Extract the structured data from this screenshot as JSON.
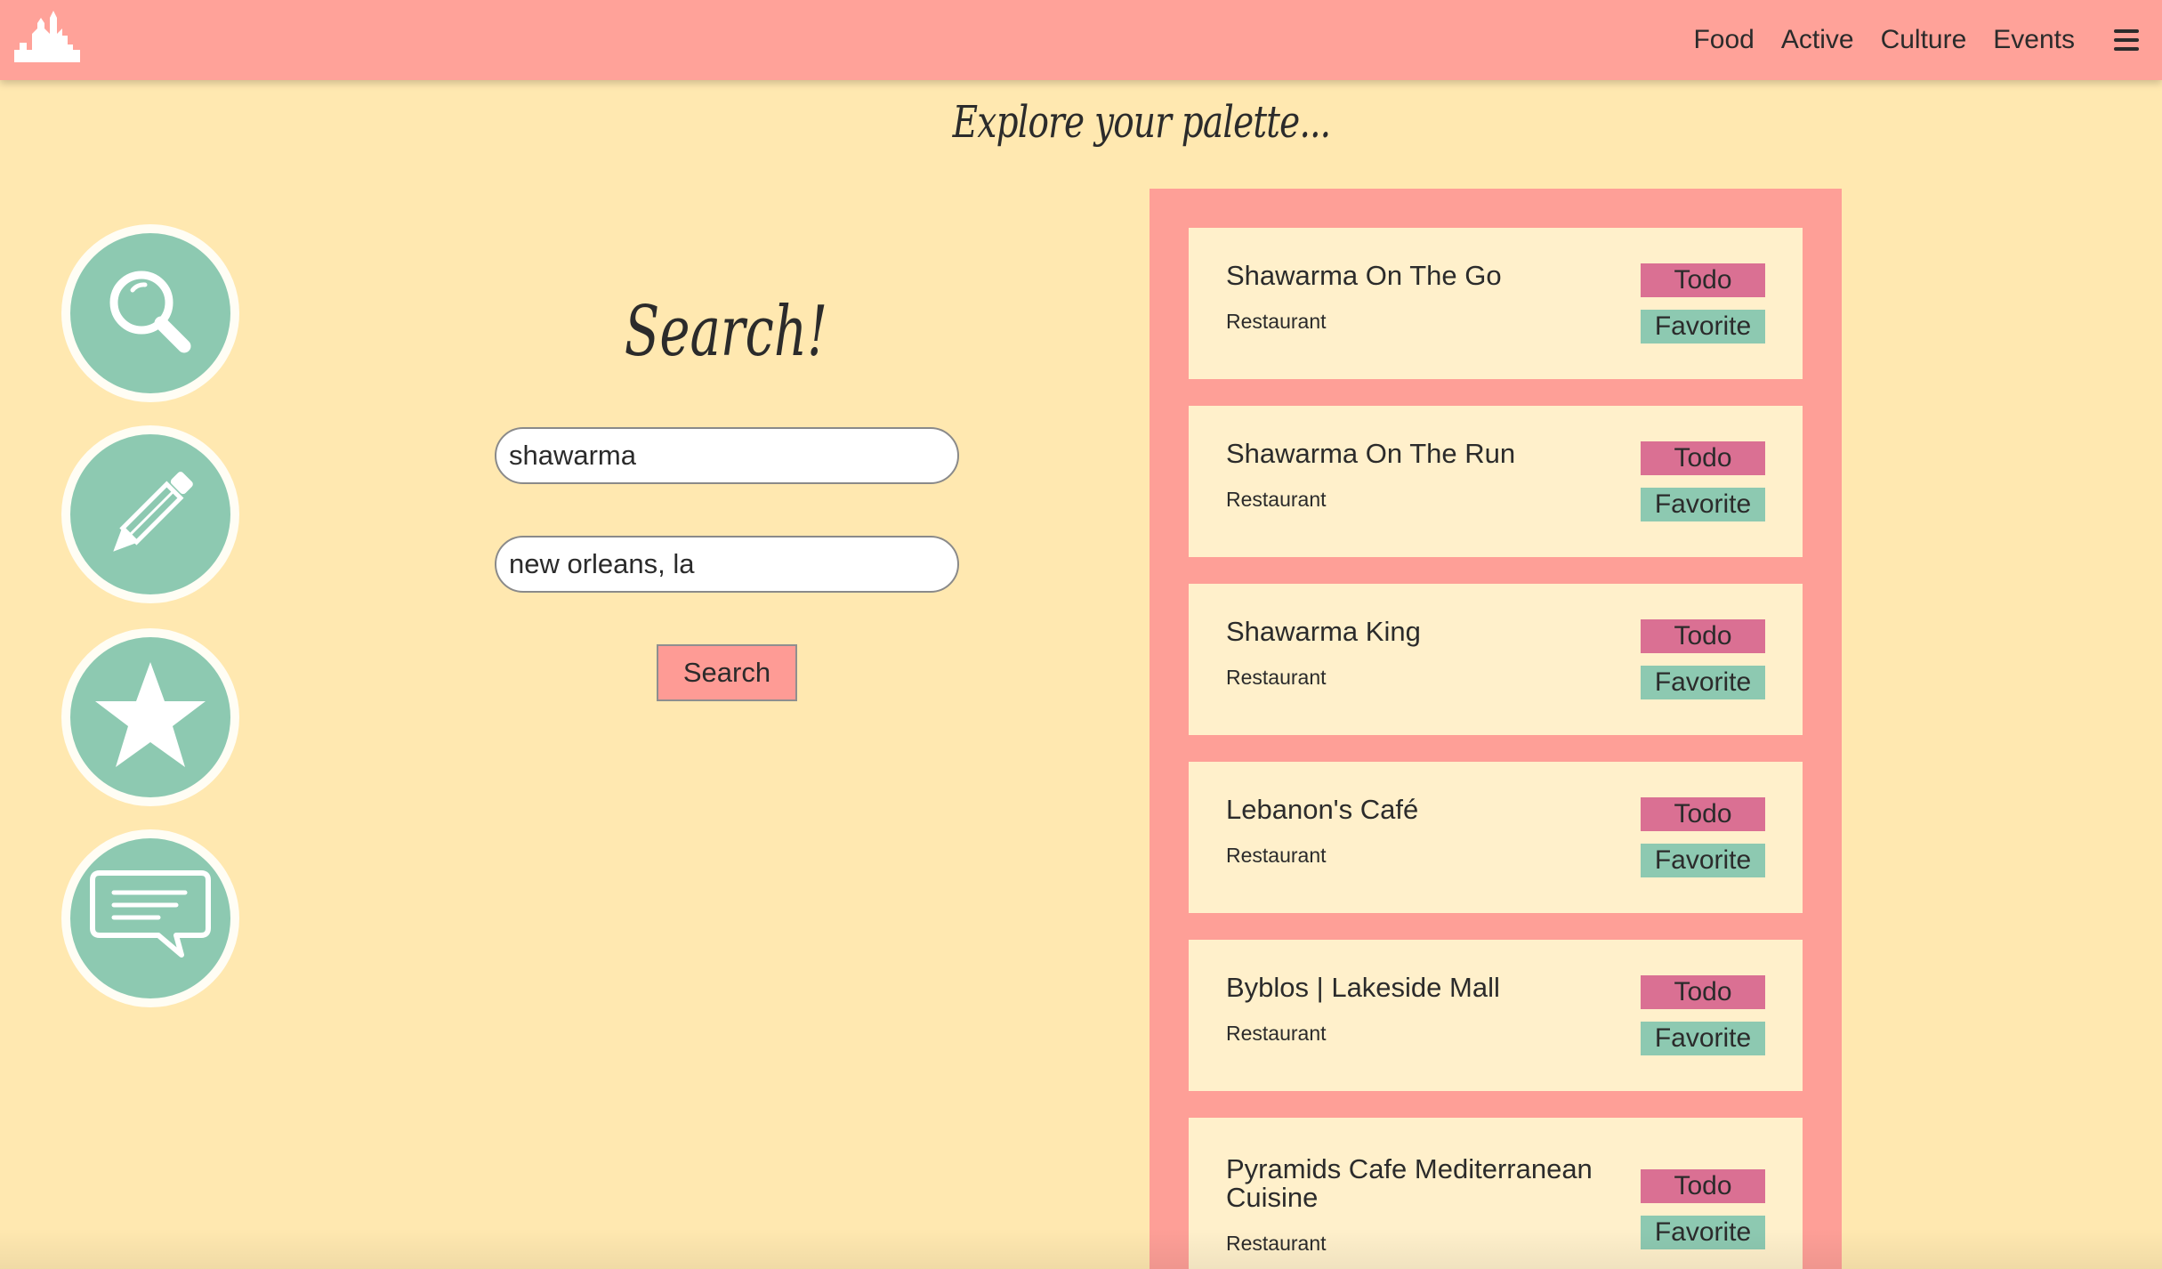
{
  "nav": {
    "logo_icon": "city-skyline-icon",
    "links": [
      "Food",
      "Active",
      "Culture",
      "Events"
    ],
    "menu_icon": "hamburger-menu-icon"
  },
  "tagline": "Explore your palette...",
  "side_buttons": [
    {
      "icon": "search-icon"
    },
    {
      "icon": "pencil-icon"
    },
    {
      "icon": "star-icon"
    },
    {
      "icon": "chat-icon"
    }
  ],
  "search": {
    "title": "Search!",
    "term_value": "shawarma",
    "location_value": "new orleans, la",
    "button_label": "Search"
  },
  "results": [
    {
      "name": "Shawarma On The Go",
      "type": "Restaurant",
      "todo_label": "Todo",
      "favorite_label": "Favorite"
    },
    {
      "name": "Shawarma On The Run",
      "type": "Restaurant",
      "todo_label": "Todo",
      "favorite_label": "Favorite"
    },
    {
      "name": "Shawarma King",
      "type": "Restaurant",
      "todo_label": "Todo",
      "favorite_label": "Favorite"
    },
    {
      "name": "Lebanon's Café",
      "type": "Restaurant",
      "todo_label": "Todo",
      "favorite_label": "Favorite"
    },
    {
      "name": "Byblos | Lakeside Mall",
      "type": "Restaurant",
      "todo_label": "Todo",
      "favorite_label": "Favorite"
    },
    {
      "name": "Pyramids Cafe Mediterranean Cuisine",
      "type": "Restaurant",
      "todo_label": "Todo",
      "favorite_label": "Favorite"
    }
  ],
  "colors": {
    "background": "#ffe8b0",
    "navbar": "#ffa299",
    "accent_green": "#8dc9b1",
    "todo_pink": "#da7093",
    "card": "#fff0cb"
  }
}
